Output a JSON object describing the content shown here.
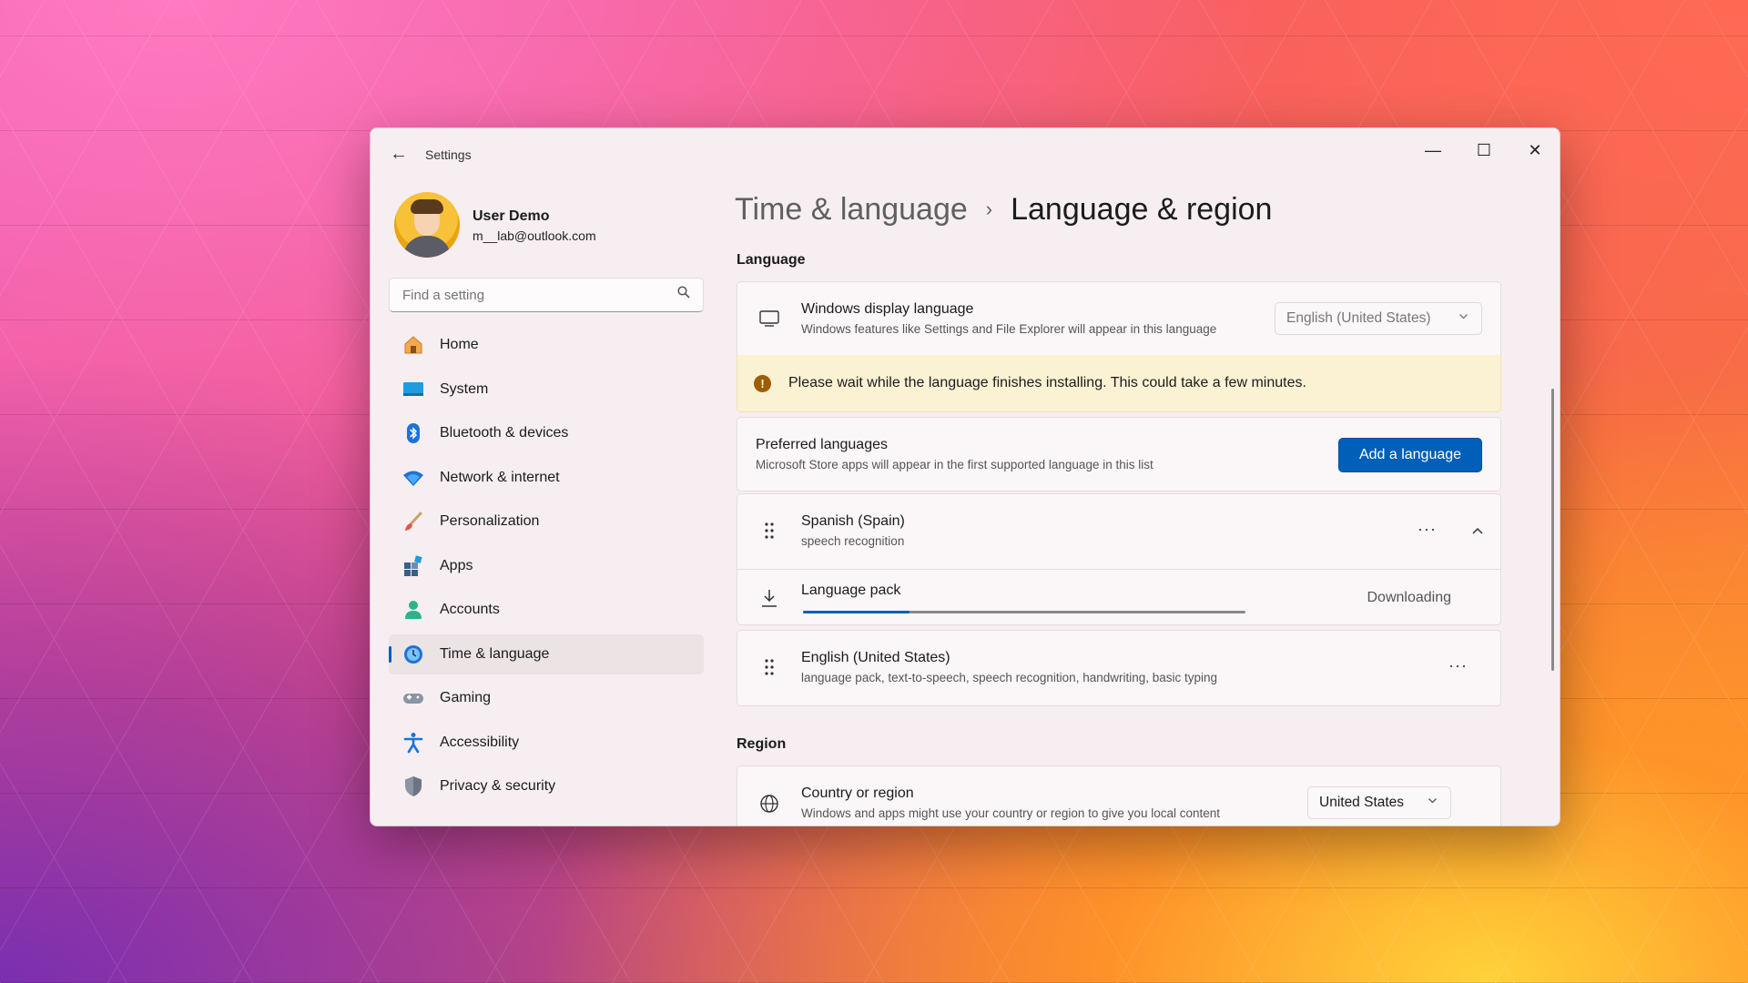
{
  "app": {
    "title": "Settings"
  },
  "window_controls": {
    "back": "←",
    "minimize": "—",
    "maximize": "☐",
    "close": "✕"
  },
  "user": {
    "name": "User Demo",
    "email": "m__lab@outlook.com"
  },
  "search": {
    "placeholder": "Find a setting"
  },
  "nav": {
    "items": [
      {
        "label": "Home",
        "icon": "home-icon"
      },
      {
        "label": "System",
        "icon": "system-icon"
      },
      {
        "label": "Bluetooth & devices",
        "icon": "bluetooth-icon"
      },
      {
        "label": "Network & internet",
        "icon": "wifi-icon"
      },
      {
        "label": "Personalization",
        "icon": "brush-icon"
      },
      {
        "label": "Apps",
        "icon": "apps-icon"
      },
      {
        "label": "Accounts",
        "icon": "accounts-icon"
      },
      {
        "label": "Time & language",
        "icon": "time-language-icon",
        "selected": true
      },
      {
        "label": "Gaming",
        "icon": "gaming-icon"
      },
      {
        "label": "Accessibility",
        "icon": "accessibility-icon"
      },
      {
        "label": "Privacy & security",
        "icon": "shield-icon"
      }
    ]
  },
  "breadcrumb": {
    "parent": "Time & language",
    "separator": "›",
    "current": "Language & region"
  },
  "language": {
    "heading": "Language",
    "display": {
      "title": "Windows display language",
      "subtitle": "Windows features like Settings and File Explorer will appear in this language",
      "value": "English (United States)"
    },
    "warning": "Please wait while the language finishes installing. This could take a few minutes.",
    "preferred": {
      "title": "Preferred languages",
      "subtitle": "Microsoft Store apps will appear in the first supported language in this list",
      "button": "Add a language"
    },
    "list": [
      {
        "name": "Spanish (Spain)",
        "features": "speech recognition"
      },
      {
        "name": "English (United States)",
        "features": "language pack, text-to-speech, speech recognition, handwriting, basic typing"
      }
    ],
    "pack": {
      "title": "Language pack",
      "status": "Downloading",
      "progress": 0.24
    }
  },
  "region": {
    "heading": "Region",
    "country": {
      "title": "Country or region",
      "subtitle": "Windows and apps might use your country or region to give you local content",
      "value": "United States"
    }
  },
  "colors": {
    "accent": "#005fb8",
    "warning_bg": "#fbf2d4",
    "warning_icon": "#9d5d00"
  }
}
